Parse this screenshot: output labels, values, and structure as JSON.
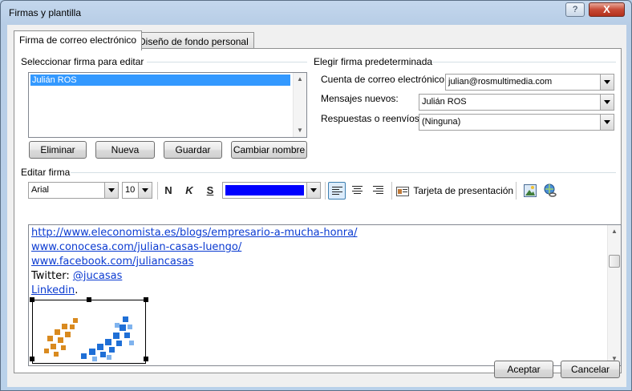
{
  "window": {
    "title": "Firmas y plantilla",
    "help_label": "?",
    "close_label": "X"
  },
  "tabs": [
    {
      "label": "Firma de correo electrónico",
      "active": true
    },
    {
      "label": "Diseño de fondo personal",
      "active": false
    }
  ],
  "select_signature": {
    "label": "Seleccionar firma para editar",
    "items": [
      "Julián ROS"
    ],
    "selected": "Julián ROS"
  },
  "signature_buttons": {
    "delete": "Eliminar",
    "new": "Nueva",
    "save": "Guardar",
    "rename": "Cambiar nombre"
  },
  "default_signature": {
    "label": "Elegir firma predeterminada",
    "account_label": "Cuenta de correo electrónico:",
    "account_value": "julian@rosmultimedia.com",
    "new_messages_label": "Mensajes nuevos:",
    "new_messages_value": "Julián ROS",
    "replies_label": "Respuestas o reenvíos:",
    "replies_value": "(Ninguna)"
  },
  "edit_signature": {
    "label": "Editar firma",
    "font": "Arial",
    "size": "10",
    "bold": "N",
    "italic": "K",
    "underline": "S",
    "font_color": "#0000ff",
    "business_card_label": "Tarjeta de presentación",
    "lines": [
      {
        "text": "http://www.eleconomista.es/blogs/empresario-a-mucha-honra/",
        "link": true
      },
      {
        "text": "www.conocesa.com/julian-casas-luengo/",
        "link": true
      },
      {
        "text": "www.facebook.com/juliancasas",
        "link": true
      }
    ],
    "twitter_prefix": "Twitter: ",
    "twitter_handle": "@jucasas",
    "linkedin": "Linkedin",
    "linkedin_suffix": "."
  },
  "footer": {
    "ok": "Aceptar",
    "cancel": "Cancelar"
  }
}
